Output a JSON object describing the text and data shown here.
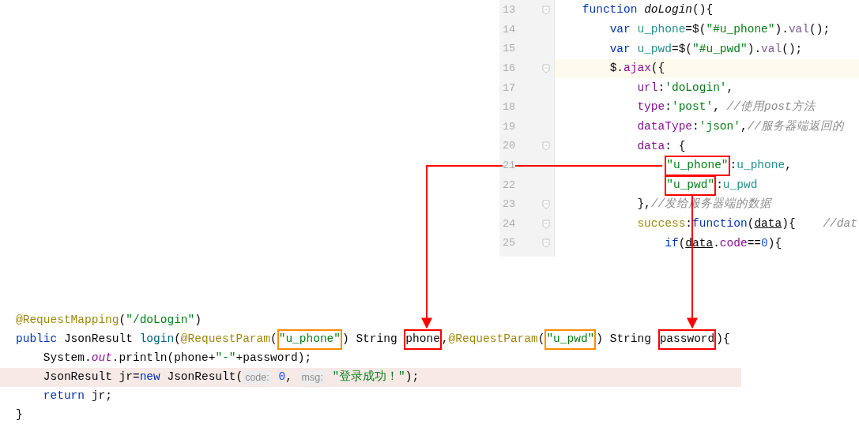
{
  "js_editor": {
    "lines": [
      {
        "number": "13",
        "fold": true,
        "highlighted": false,
        "tokens": [
          {
            "t": "    function",
            "kind": "keyword"
          },
          {
            "t": " doLogin",
            "kind": "function"
          },
          {
            "t": "(){",
            "kind": "plain"
          }
        ]
      },
      {
        "number": "14",
        "fold": false,
        "highlighted": false,
        "tokens": [
          {
            "t": "        var",
            "kind": "keyword"
          },
          {
            "t": " u_phone",
            "kind": "variable"
          },
          {
            "t": "=$(",
            "kind": "plain"
          },
          {
            "t": "\"#u_phone\"",
            "kind": "string"
          },
          {
            "t": ").",
            "kind": "plain"
          },
          {
            "t": "val",
            "kind": "method"
          },
          {
            "t": "();",
            "kind": "plain"
          }
        ]
      },
      {
        "number": "15",
        "fold": false,
        "highlighted": false,
        "tokens": [
          {
            "t": "        var",
            "kind": "keyword"
          },
          {
            "t": " u_pwd",
            "kind": "variable"
          },
          {
            "t": "=$(",
            "kind": "plain"
          },
          {
            "t": "\"#u_pwd\"",
            "kind": "string"
          },
          {
            "t": ").",
            "kind": "plain"
          },
          {
            "t": "val",
            "kind": "method"
          },
          {
            "t": "();",
            "kind": "plain"
          }
        ]
      },
      {
        "number": "16",
        "fold": true,
        "highlighted": true,
        "tokens": [
          {
            "t": "        $.",
            "kind": "plain"
          },
          {
            "t": "ajax",
            "kind": "property"
          },
          {
            "t": "({",
            "kind": "plain"
          }
        ]
      },
      {
        "number": "17",
        "fold": false,
        "highlighted": false,
        "tokens": [
          {
            "t": "            url",
            "kind": "property"
          },
          {
            "t": ":",
            "kind": "plain"
          },
          {
            "t": "'doLogin'",
            "kind": "string"
          },
          {
            "t": ",",
            "kind": "plain"
          }
        ]
      },
      {
        "number": "18",
        "fold": false,
        "highlighted": false,
        "tokens": [
          {
            "t": "            type",
            "kind": "property"
          },
          {
            "t": ":",
            "kind": "plain"
          },
          {
            "t": "'post'",
            "kind": "string"
          },
          {
            "t": ",",
            "kind": "plain"
          },
          {
            "t": " //使用post方法",
            "kind": "comment"
          }
        ]
      },
      {
        "number": "19",
        "fold": false,
        "highlighted": false,
        "tokens": [
          {
            "t": "            dataType",
            "kind": "property"
          },
          {
            "t": ":",
            "kind": "plain"
          },
          {
            "t": "'json'",
            "kind": "string"
          },
          {
            "t": ",",
            "kind": "plain"
          },
          {
            "t": "//服务器端返回的",
            "kind": "comment"
          }
        ]
      },
      {
        "number": "20",
        "fold": true,
        "highlighted": false,
        "tokens": [
          {
            "t": "            data",
            "kind": "property"
          },
          {
            "t": ": {",
            "kind": "plain"
          }
        ]
      },
      {
        "number": "21",
        "fold": false,
        "highlighted": false,
        "tokens": [
          {
            "t": "                \"u_phone\"",
            "kind": "string",
            "color": "#ff0000"
          },
          {
            "t": ":",
            "kind": "plain"
          },
          {
            "t": "u_phone",
            "kind": "variable"
          },
          {
            "t": ",",
            "kind": "plain"
          }
        ]
      },
      {
        "number": "22",
        "fold": false,
        "highlighted": false,
        "tokens": [
          {
            "t": "                \"u_pwd\"",
            "kind": "string",
            "color": "#ff0000"
          },
          {
            "t": ":",
            "kind": "plain"
          },
          {
            "t": "u_pwd",
            "kind": "variable"
          }
        ]
      },
      {
        "number": "23",
        "fold": true,
        "highlighted": false,
        "tokens": [
          {
            "t": "            },",
            "kind": "plain"
          },
          {
            "t": "//发给服务器端的数据",
            "kind": "comment"
          }
        ]
      },
      {
        "number": "24",
        "fold": true,
        "highlighted": false,
        "tokens": [
          {
            "t": "            success",
            "kind": "annotation"
          },
          {
            "t": ":",
            "kind": "plain"
          },
          {
            "t": "function",
            "kind": "keyword"
          },
          {
            "t": "(",
            "kind": "plain"
          },
          {
            "t": "data",
            "kind": "param"
          },
          {
            "t": "){",
            "kind": "plain"
          },
          {
            "t": "    //dat",
            "kind": "comment"
          }
        ]
      },
      {
        "number": "25",
        "fold": true,
        "highlighted": false,
        "tokens": [
          {
            "t": "                if",
            "kind": "keyword"
          },
          {
            "t": "(",
            "kind": "plain"
          },
          {
            "t": "data",
            "kind": "param"
          },
          {
            "t": ".",
            "kind": "plain"
          },
          {
            "t": "code",
            "kind": "property"
          },
          {
            "t": "==",
            "kind": "plain"
          },
          {
            "t": "0",
            "kind": "number"
          },
          {
            "t": "){",
            "kind": "plain"
          }
        ]
      }
    ]
  },
  "java_code": {
    "lines": [
      {
        "highlighted": false,
        "tokens": [
          {
            "t": "@RequestMapping",
            "kind": "annotation"
          },
          {
            "t": "(",
            "kind": "plain"
          },
          {
            "t": "\"/doLogin\"",
            "kind": "string"
          },
          {
            "t": ")",
            "kind": "plain"
          }
        ]
      },
      {
        "highlighted": false,
        "tokens": [
          {
            "t": "public",
            "kind": "keyword"
          },
          {
            "t": " JsonResult",
            "kind": "plain"
          },
          {
            "t": " login",
            "kind": "declaration"
          },
          {
            "t": "(",
            "kind": "plain"
          },
          {
            "t": "@RequestParam",
            "kind": "annotation"
          },
          {
            "t": "(",
            "kind": "plain"
          },
          {
            "t": "\"u_phone\"",
            "kind": "string",
            "color": "#ff8c00"
          },
          {
            "t": ") String",
            "kind": "plain"
          },
          {
            "t": " phone",
            "kind": "plain",
            "color": "#ff0000"
          },
          {
            "t": ",",
            "kind": "plain"
          },
          {
            "t": "@RequestParam",
            "kind": "annotation"
          },
          {
            "t": "(",
            "kind": "plain"
          },
          {
            "t": "\"u_pwd\"",
            "kind": "string",
            "color": "#ff8c00"
          },
          {
            "t": ") String",
            "kind": "plain"
          },
          {
            "t": " password",
            "kind": "plain",
            "color": "#ff0000"
          },
          {
            "t": "){",
            "kind": "plain"
          }
        ]
      },
      {
        "highlighted": false,
        "tokens": [
          {
            "t": "    System.",
            "kind": "plain"
          },
          {
            "t": "out",
            "kind": "field"
          },
          {
            "t": ".println(phone+",
            "kind": "plain"
          },
          {
            "t": "\"-\"",
            "kind": "string"
          },
          {
            "t": "+password);",
            "kind": "plain"
          }
        ]
      },
      {
        "highlighted": true,
        "tokens": [
          {
            "t": "    JsonResult jr=",
            "kind": "plain"
          },
          {
            "t": "new",
            "kind": "keyword"
          },
          {
            "t": " JsonResult(",
            "kind": "plain"
          },
          {
            "t": "code:",
            "kind": "hint"
          },
          {
            "t": " 0",
            "kind": "number"
          },
          {
            "t": ",",
            "kind": "plain"
          },
          {
            "t": " msg:",
            "kind": "hint"
          },
          {
            "t": " \"登录成功！\"",
            "kind": "string"
          },
          {
            "t": ");",
            "kind": "plain"
          }
        ]
      },
      {
        "highlighted": false,
        "tokens": [
          {
            "t": "    return",
            "kind": "keyword"
          },
          {
            "t": " jr;",
            "kind": "plain"
          }
        ]
      },
      {
        "highlighted": false,
        "tokens": [
          {
            "t": "}",
            "kind": "plain"
          }
        ]
      }
    ]
  }
}
